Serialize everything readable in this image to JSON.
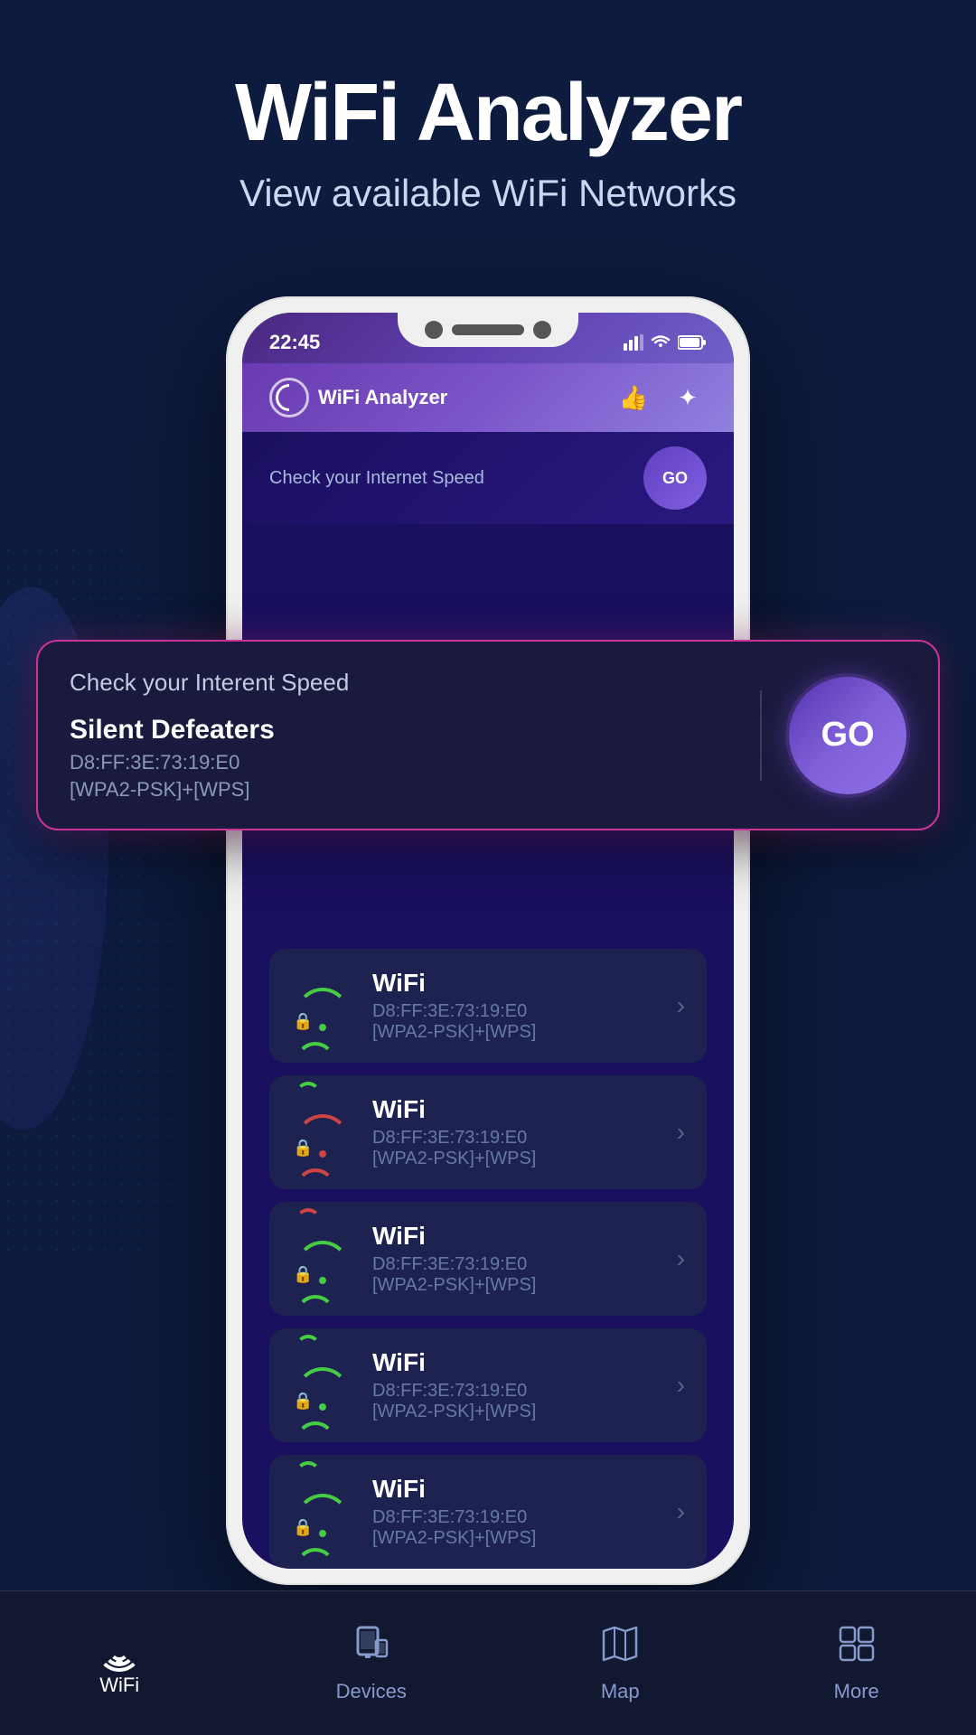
{
  "page": {
    "background_color": "#0d1b3e"
  },
  "header": {
    "title": "WiFi Analyzer",
    "subtitle": "View available WiFi Networks"
  },
  "phone": {
    "status_bar": {
      "time": "22:45",
      "bluetooth_icon": "bluetooth",
      "signal_icon": "signal",
      "wifi_icon": "wifi",
      "battery_icon": "battery"
    },
    "app_header": {
      "logo_text_bold": "WiFi",
      "logo_text_normal": " Analyzer",
      "like_icon": "thumbs-up",
      "settings_icon": "brightness"
    },
    "speed_banner": {
      "text": "Check your Internet Speed"
    }
  },
  "speed_card": {
    "title": "Check your Interent Speed",
    "ssid": "Silent Defeaters",
    "mac": "D8:FF:3E:73:19:E0",
    "security": "[WPA2-PSK]+[WPS]",
    "go_button_label": "GO"
  },
  "wifi_networks": [
    {
      "name": "WiFi",
      "mac": "D8:FF:3E:73:19:E0",
      "security": "[WPA2-PSK]+[WPS]",
      "signal": "strong",
      "color": "green",
      "locked": true
    },
    {
      "name": "WiFi",
      "mac": "D8:FF:3E:73:19:E0",
      "security": "[WPA2-PSK]+[WPS]",
      "signal": "weak",
      "color": "red",
      "locked": true
    },
    {
      "name": "WiFi",
      "mac": "D8:FF:3E:73:19:E0",
      "security": "[WPA2-PSK]+[WPS]",
      "signal": "strong",
      "color": "green",
      "locked": true
    },
    {
      "name": "WiFi",
      "mac": "D8:FF:3E:73:19:E0",
      "security": "[WPA2-PSK]+[WPS]",
      "signal": "medium",
      "color": "green",
      "locked": true
    },
    {
      "name": "WiFi",
      "mac": "D8:FF:3E:73:19:E0",
      "security": "[WPA2-PSK]+[WPS]",
      "signal": "strong",
      "color": "green",
      "locked": true
    }
  ],
  "bottom_nav": {
    "items": [
      {
        "label": "WiFi",
        "icon": "wifi",
        "active": true
      },
      {
        "label": "Devices",
        "icon": "devices",
        "active": false
      },
      {
        "label": "Map",
        "icon": "map",
        "active": false
      },
      {
        "label": "More",
        "icon": "more",
        "active": false
      }
    ]
  }
}
